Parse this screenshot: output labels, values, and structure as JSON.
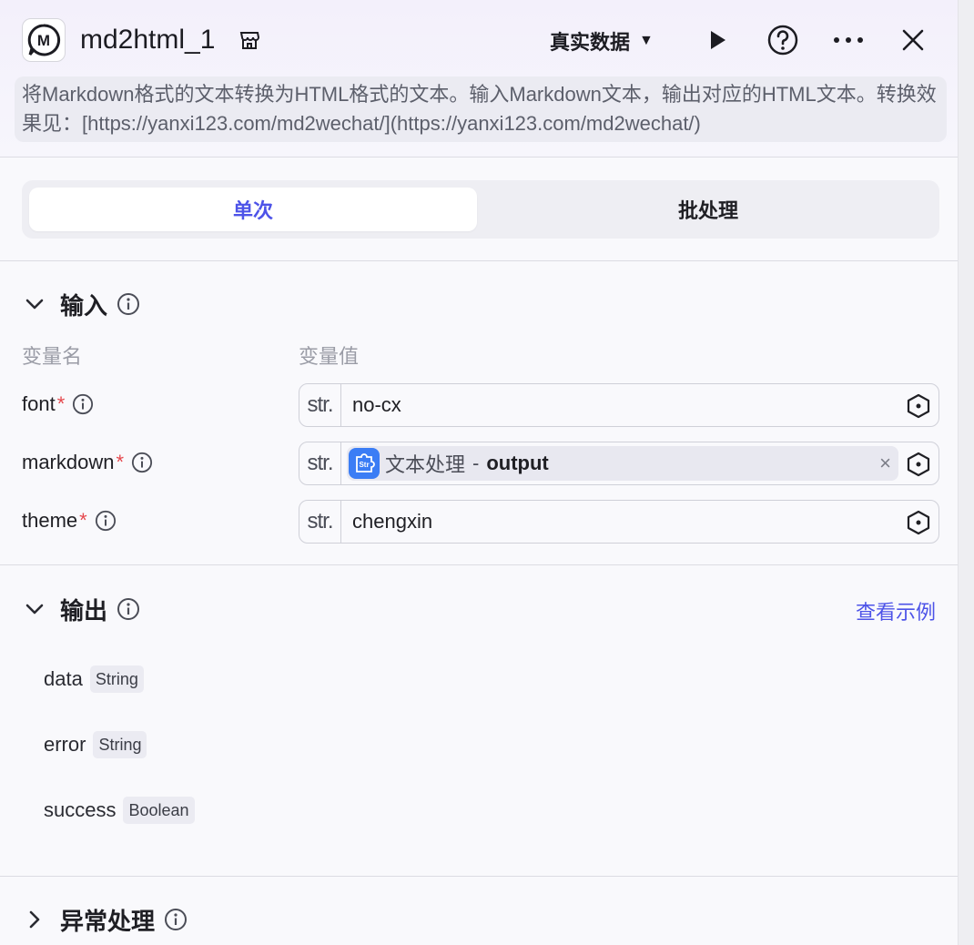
{
  "header": {
    "title": "md2html_1",
    "data_mode": "真实数据",
    "description": "将Markdown格式的文本转换为HTML格式的文本。输入Markdown文本，输出对应的HTML文本。转换效果见：[https://yanxi123.com/md2wechat/](https://yanxi123.com/md2wechat/)"
  },
  "tabs": {
    "single": "单次",
    "batch": "批处理"
  },
  "input": {
    "title": "输入",
    "col_name": "变量名",
    "col_value": "变量值",
    "rows": [
      {
        "name": "font",
        "required": "*",
        "type": "str.",
        "value": "no-cx"
      },
      {
        "name": "markdown",
        "required": "*",
        "type": "str.",
        "ref_source": "文本处理",
        "ref_sep": "-",
        "ref_var": "output"
      },
      {
        "name": "theme",
        "required": "*",
        "type": "str.",
        "value": "chengxin"
      }
    ]
  },
  "output": {
    "title": "输出",
    "example_link": "查看示例",
    "fields": [
      {
        "name": "data",
        "type": "String"
      },
      {
        "name": "error",
        "type": "String"
      },
      {
        "name": "success",
        "type": "Boolean"
      }
    ]
  },
  "exception": {
    "title": "异常处理"
  },
  "colors": {
    "accent": "#4d53e8",
    "required": "#e5484d",
    "ref_icon": "#3b7df5"
  }
}
